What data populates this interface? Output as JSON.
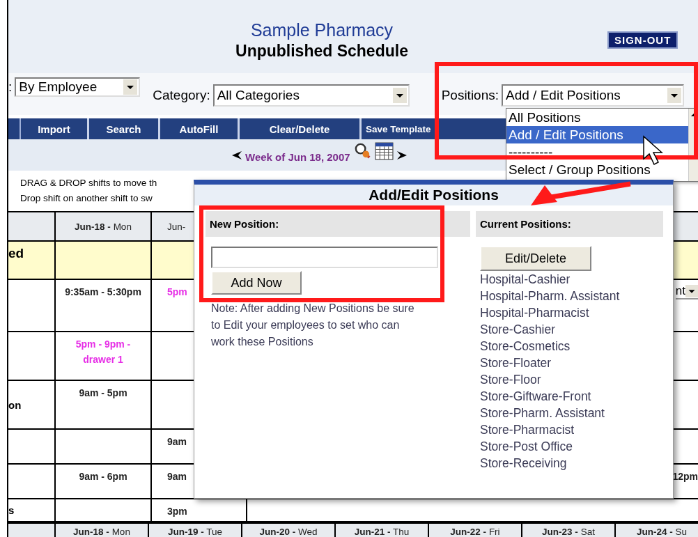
{
  "header": {
    "title": "Sample Pharmacy",
    "subtitle": "Unpublished Schedule",
    "sign_out": "SIGN-OUT"
  },
  "filters": [
    {
      "label": ":",
      "value": "By Employee"
    },
    {
      "label": "Category:",
      "value": "All Categories"
    },
    {
      "label": "Positions:",
      "value": "Add / Edit Positions"
    }
  ],
  "toolbar": [
    "Import",
    "Search",
    "AutoFill",
    "Clear/Delete",
    "Save Template"
  ],
  "week": "Week of Jun 18, 2007",
  "instructions": [
    "DRAG & DROP shifts to move th",
    "Drop shift on another shift to sw"
  ],
  "schedule": {
    "top_headers": [
      "**Jun-18 -** Mon",
      "Jun-"
    ],
    "rows": [
      {
        "name": "ed",
        "kind": "group"
      },
      {
        "kind": "shift",
        "mon": {
          "text": "9:35am - 5:30pm",
          "kind": "assigned"
        },
        "tue": {
          "text": "5pm",
          "kind": "unassigned"
        },
        "sun": {
          "text": "nt",
          "kind": "select"
        }
      },
      {
        "kind": "shift",
        "mon": {
          "text": "5pm - 9pm -drawer 1",
          "kind": "unassigned"
        }
      },
      {
        "name": "on",
        "kind": "shift",
        "mon": {
          "text": "9am - 5pm",
          "kind": "assigned"
        }
      },
      {
        "kind": "shift",
        "tue": {
          "text": "9am",
          "kind": "assigned"
        }
      },
      {
        "kind": "shift",
        "mon": {
          "text": "9am - 6pm",
          "kind": "assigned"
        },
        "tue": {
          "text": "9am",
          "kind": "assigned"
        },
        "sun": {
          "text": "12pm",
          "kind": "assigned"
        }
      },
      {
        "name": "s",
        "kind": "shift",
        "tue": {
          "text": "3pm",
          "kind": "assigned"
        }
      }
    ],
    "bottom_headers": [
      "**Jun-18 -** Mon",
      "**Jun-19 -** Tue",
      "**Jun-20 -** Wed",
      "**Jun-21 -** Thu",
      "**Jun-22 -** Fri",
      "**Jun-23 -** Sat",
      "**Jun-24 -** Su"
    ]
  },
  "positions_dropdown": {
    "options": [
      {
        "label": "All Positions",
        "selected": false
      },
      {
        "label": "Add / Edit Positions",
        "selected": true
      },
      {
        "label": "----------",
        "selected": false
      },
      {
        "label": "Select / Group Positions",
        "selected": false
      }
    ]
  },
  "dialog": {
    "title": "Add/Edit Positions",
    "new_position": {
      "heading": "New Position:",
      "button": "Add Now",
      "note": "Note: After adding New Positions be sure to Edit your employees to set who can work these Positions"
    },
    "current_positions": {
      "heading": "Current Positions:",
      "button": "Edit/Delete",
      "items": [
        "Hospital-Cashier",
        "Hospital-Pharm. Assistant",
        "Hospital-Pharmacist",
        "Store-Cashier",
        "Store-Cosmetics",
        "Store-Floater",
        "Store-Floor",
        "Store-Giftware-Front",
        "Store-Pharm. Assistant",
        "Store-Pharmacist",
        "Store-Post Office",
        "Store-Receiving"
      ]
    }
  }
}
